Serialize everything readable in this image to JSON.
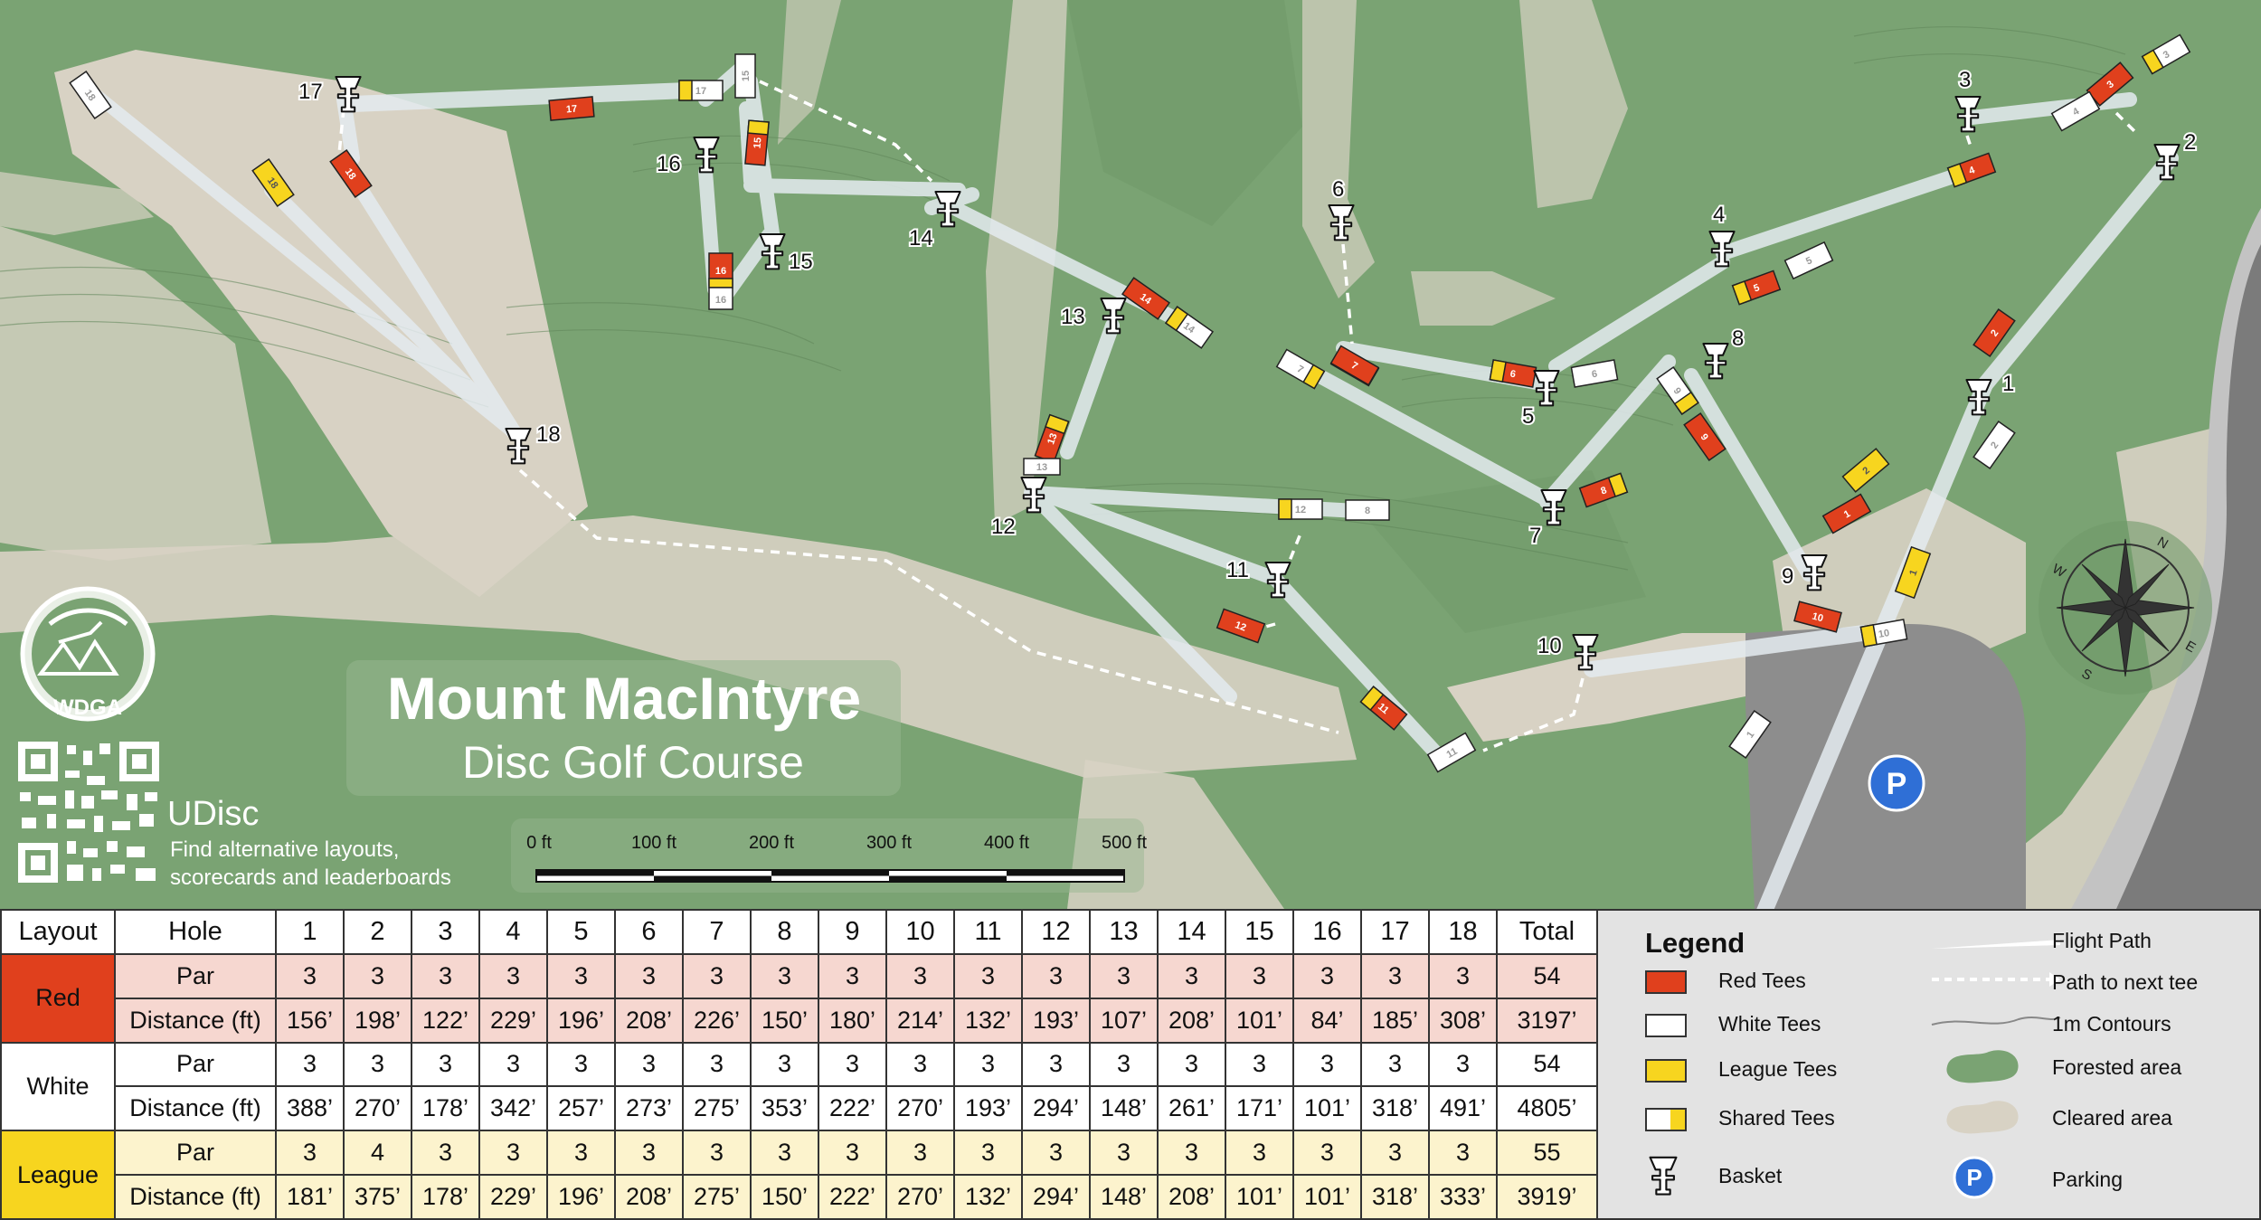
{
  "map": {
    "title": "Mount MacIntyre",
    "subtitle": "Disc Golf Course",
    "logo_text": "WDGA",
    "udisc_brand": "UDisc",
    "udisc_text_1": "Find alternative layouts,",
    "udisc_text_2": "scorecards and leaderboards",
    "scale_labels": [
      "0 ft",
      "100 ft",
      "200 ft",
      "300 ft",
      "400 ft",
      "500 ft"
    ],
    "parking_symbol": "P",
    "compass_letters": {
      "n": "N",
      "s": "S",
      "e": "E",
      "w": "W"
    },
    "colors": {
      "forest": "#7aa373",
      "cleared": "#d8d2c4",
      "red_tee": "#e0401d",
      "league_tee": "#f7d51f",
      "white_tee": "#ffffff",
      "parking_lot": "#8d8d8d",
      "parking_icon": "#2f6fd6"
    },
    "basket_numbers": [
      "1",
      "2",
      "3",
      "4",
      "5",
      "6",
      "7",
      "8",
      "9",
      "10",
      "11",
      "12",
      "13",
      "14",
      "15",
      "16",
      "17",
      "18"
    ],
    "tee_numbers": [
      "1",
      "2",
      "3",
      "4",
      "5",
      "6",
      "7",
      "8",
      "9",
      "10",
      "11",
      "12",
      "13",
      "14",
      "15",
      "16",
      "17",
      "18"
    ]
  },
  "scorecard": {
    "headers": [
      "Layout",
      "Hole",
      "1",
      "2",
      "3",
      "4",
      "5",
      "6",
      "7",
      "8",
      "9",
      "10",
      "11",
      "12",
      "13",
      "14",
      "15",
      "16",
      "17",
      "18",
      "Total"
    ],
    "layouts": [
      {
        "name": "Red",
        "color": "#e0401d",
        "par_label": "Par",
        "par": [
          "3",
          "3",
          "3",
          "3",
          "3",
          "3",
          "3",
          "3",
          "3",
          "3",
          "3",
          "3",
          "3",
          "3",
          "3",
          "3",
          "3",
          "3"
        ],
        "par_total": "54",
        "dist_label": "Distance (ft)",
        "dist": [
          "156’",
          "198’",
          "122’",
          "229’",
          "196’",
          "208’",
          "226’",
          "150’",
          "180’",
          "214’",
          "132’",
          "193’",
          "107’",
          "208’",
          "101’",
          "84’",
          "185’",
          "308’"
        ],
        "dist_total": "3197’"
      },
      {
        "name": "White",
        "color": "#ffffff",
        "par_label": "Par",
        "par": [
          "3",
          "3",
          "3",
          "3",
          "3",
          "3",
          "3",
          "3",
          "3",
          "3",
          "3",
          "3",
          "3",
          "3",
          "3",
          "3",
          "3",
          "3"
        ],
        "par_total": "54",
        "dist_label": "Distance (ft)",
        "dist": [
          "388’",
          "270’",
          "178’",
          "342’",
          "257’",
          "273’",
          "275’",
          "353’",
          "222’",
          "270’",
          "193’",
          "294’",
          "148’",
          "261’",
          "171’",
          "101’",
          "318’",
          "491’"
        ],
        "dist_total": "4805’"
      },
      {
        "name": "League",
        "color": "#f7d51f",
        "par_label": "Par",
        "par": [
          "3",
          "4",
          "3",
          "3",
          "3",
          "3",
          "3",
          "3",
          "3",
          "3",
          "3",
          "3",
          "3",
          "3",
          "3",
          "3",
          "3",
          "3"
        ],
        "par_total": "55",
        "dist_label": "Distance (ft)",
        "dist": [
          "181’",
          "375’",
          "178’",
          "229’",
          "196’",
          "208’",
          "275’",
          "150’",
          "222’",
          "270’",
          "132’",
          "294’",
          "148’",
          "208’",
          "101’",
          "101’",
          "318’",
          "333’"
        ],
        "dist_total": "3919’"
      }
    ]
  },
  "legend": {
    "title": "Legend",
    "items": {
      "red_tees": "Red Tees",
      "white_tees": "White Tees",
      "league_tees": "League Tees",
      "shared_tees": "Shared Tees",
      "basket": "Basket",
      "flight_path": "Flight Path",
      "path_next_tee": "Path to next tee",
      "contours": "1m Contours",
      "forested": "Forested area",
      "cleared": "Cleared area",
      "parking": "Parking"
    },
    "parking_symbol": "P"
  }
}
